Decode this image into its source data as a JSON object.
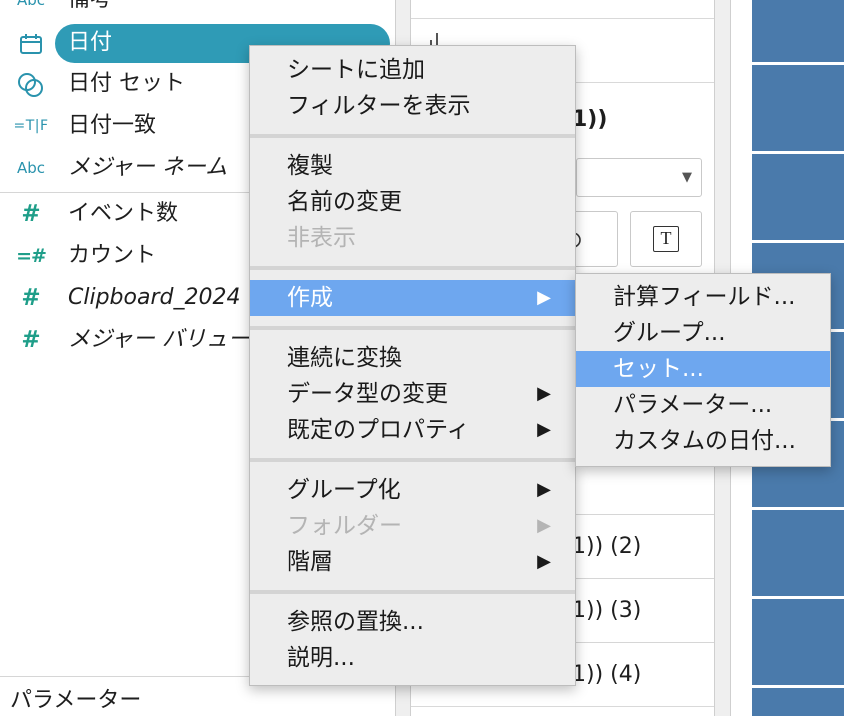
{
  "colors": {
    "dimension": "#2a93ad",
    "measure": "#1f9e89",
    "selection": "#2f9bb6",
    "menu_highlight": "#6ea7ef",
    "mark_blue": "#4a7aab",
    "disabled_text": "#b4b4b4"
  },
  "data_pane": {
    "dimensions": [
      {
        "icon": "abc-icon",
        "icon_text": "Abc",
        "label": "備考"
      },
      {
        "icon": "calendar-icon",
        "label": "日付",
        "selected": true
      },
      {
        "icon": "set-icon",
        "label": "日付 セット"
      },
      {
        "icon": "boolean-calc-icon",
        "icon_text": "=T|F",
        "label": "日付一致"
      },
      {
        "icon": "abc-icon",
        "icon_text": "Abc",
        "label": "メジャー ネーム"
      }
    ],
    "measures": [
      {
        "icon": "number-icon",
        "icon_text": "#",
        "label": "イベント数"
      },
      {
        "icon": "calc-number-icon",
        "icon_text": "=#",
        "label": "カウント"
      },
      {
        "icon": "number-icon",
        "icon_text": "#",
        "label": "Clipboard_2024"
      },
      {
        "icon": "number-icon",
        "icon_text": "#",
        "label": "メジャー バリュー"
      }
    ],
    "parameters_heading": "パラメーター"
  },
  "marks_card": {
    "toolbar_icon": "bar-chart-icon",
    "partial_title": "1))",
    "mark_type_dropdown": {
      "arrow": "▼"
    },
    "buttons": [
      {
        "icon": "size-icon"
      },
      {
        "icon": "label-icon",
        "glyph": "T"
      }
    ],
    "rows": [
      "1)) (2)",
      "1)) (3)",
      "1)) (4)"
    ]
  },
  "context_menu": {
    "submenu_arrow": "▶",
    "groups": [
      [
        {
          "label": "シートに追加"
        },
        {
          "label": "フィルターを表示"
        }
      ],
      [
        {
          "label": "複製"
        },
        {
          "label": "名前の変更"
        },
        {
          "label": "非表示",
          "disabled": true
        }
      ],
      [
        {
          "label": "作成",
          "submenu": true,
          "highlighted": true
        }
      ],
      [
        {
          "label": "連続に変換"
        },
        {
          "label": "データ型の変更",
          "submenu": true
        },
        {
          "label": "既定のプロパティ",
          "submenu": true
        }
      ],
      [
        {
          "label": "グループ化",
          "submenu": true
        },
        {
          "label": "フォルダー",
          "submenu": true,
          "disabled": true
        },
        {
          "label": "階層",
          "submenu": true
        }
      ],
      [
        {
          "label": "参照の置換..."
        },
        {
          "label": "説明..."
        }
      ]
    ]
  },
  "create_submenu": {
    "items": [
      {
        "label": "計算フィールド..."
      },
      {
        "label": "グループ..."
      },
      {
        "label": "セット...",
        "highlighted": true
      },
      {
        "label": "パラメーター..."
      },
      {
        "label": "カスタムの日付..."
      }
    ]
  }
}
